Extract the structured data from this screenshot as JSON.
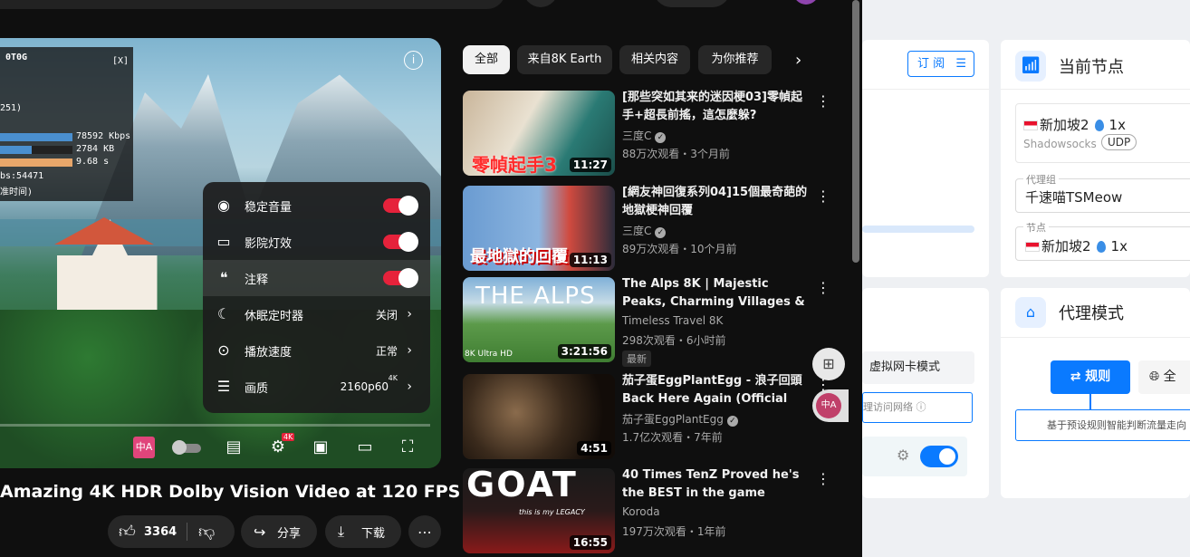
{
  "stats_panel": {
    "header": "0T0G",
    "close": "[X]",
    "line2": "251)",
    "speeds": [
      "78592 Kbps",
      "2784 KB",
      "9.68 s"
    ],
    "line_bs": "bs:54471",
    "line_time": "准时间)"
  },
  "settings_menu": {
    "items": [
      {
        "label": "稳定音量",
        "icon": "stable-volume-icon",
        "toggle": true
      },
      {
        "label": "影院灯效",
        "icon": "ambient-mode-icon",
        "toggle": true
      },
      {
        "label": "注释",
        "icon": "annotations-icon",
        "toggle": true
      },
      {
        "label": "休眠定时器",
        "icon": "sleep-timer-icon",
        "value": "关闭"
      },
      {
        "label": "播放速度",
        "icon": "playback-speed-icon",
        "value": "正常"
      },
      {
        "label": "画质",
        "icon": "quality-icon",
        "value": "2160p60",
        "badge": "4K"
      }
    ]
  },
  "player": {
    "settings_badge": "4K",
    "subtitle_icon_text": "中A"
  },
  "video_title": "Amazing 4K HDR Dolby Vision Video at 120 FPS",
  "actions": {
    "likes": "3364",
    "share": "分享",
    "download": "下载",
    "more": "⋯"
  },
  "chips": [
    "全部",
    "来自8K Earth",
    "相关内容",
    "为你推荐"
  ],
  "recommendations": [
    {
      "title": "[那些突如其来的迷因梗03]零幀起手+超長前搖，這怎麼躲?",
      "channel": "三度C",
      "meta": "88万次观看・3个月前",
      "duration": "11:27",
      "thumb_text": "零幀起手3",
      "verified": true
    },
    {
      "title": "[網友神回復系列04]15個最奇葩的地獄梗神回覆",
      "channel": "三度C",
      "meta": "89万次观看・10个月前",
      "duration": "11:13",
      "thumb_text": "最地獄的回覆",
      "verified": true
    },
    {
      "title": "The Alps 8K | Majestic Peaks, Charming Villages & Glacier ...",
      "channel": "Timeless Travel 8K",
      "meta": "298次观看・6小时前",
      "duration": "3:21:56",
      "thumb_text": "THE ALPS",
      "badge": "最新",
      "thumb_sub": "8K Ultra HD"
    },
    {
      "title": "茄子蛋EggPlantEgg - 浪子回頭 Back Here Again (Official Musi...",
      "channel": "茄子蛋EggPlantEgg",
      "meta": "1.7亿次观看・7年前",
      "duration": "4:51",
      "verified": true
    },
    {
      "title": "40 Times TenZ Proved he's the BEST in the game",
      "channel": "Koroda",
      "meta": "197万次观看・1年前",
      "duration": "16:55",
      "thumb_text": "GOAT",
      "thumb_sub": "this is my LEGACY"
    }
  ],
  "float_buttons": {
    "translate": "中A"
  },
  "right_panel": {
    "subscribe_label": "订 阅",
    "current_node_title": "当前节点",
    "node_name": "新加坡2",
    "node_rate": "1x",
    "protocol": "Shadowsocks",
    "udp": "UDP",
    "proxy_group_label": "代理组",
    "proxy_group_value": "千速喵TSMeow",
    "node_label": "节点",
    "node_value": "新加坡2",
    "node_value_rate": "1x",
    "proxy_mode_title": "代理模式",
    "tun_mode": "虚拟网卡模式",
    "rule_button": "规则",
    "global_button": "全",
    "proxy_network_hint": "理访问网络",
    "mode_description": "基于预设规则智能判断流量走向"
  },
  "colors": {
    "accent_red": "#e6223b",
    "clash_blue": "#0a7aff"
  }
}
